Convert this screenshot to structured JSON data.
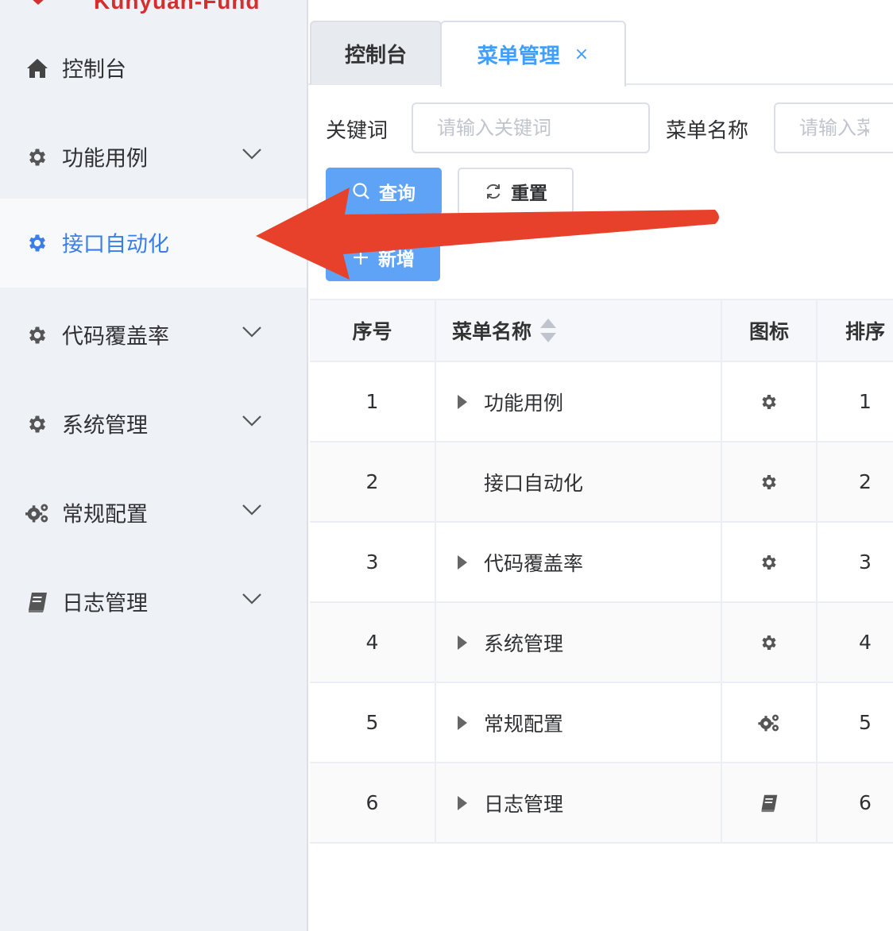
{
  "brand": {
    "name": "Kunyuan-Fund"
  },
  "sidebar": {
    "items": [
      {
        "label": "控制台",
        "icon": "home-icon",
        "has_children": false,
        "active": false
      },
      {
        "label": "功能用例",
        "icon": "gear-icon",
        "has_children": true,
        "active": false
      },
      {
        "label": "接口自动化",
        "icon": "gear-icon",
        "has_children": false,
        "active": true
      },
      {
        "label": "代码覆盖率",
        "icon": "gear-icon",
        "has_children": true,
        "active": false
      },
      {
        "label": "系统管理",
        "icon": "gear-icon",
        "has_children": true,
        "active": false
      },
      {
        "label": "常规配置",
        "icon": "gears-icon",
        "has_children": true,
        "active": false
      },
      {
        "label": "日志管理",
        "icon": "book-icon",
        "has_children": true,
        "active": false
      }
    ]
  },
  "tabs": [
    {
      "label": "控制台",
      "active": false
    },
    {
      "label": "菜单管理",
      "active": true,
      "close": "×"
    }
  ],
  "search": {
    "keyword_label": "关键词",
    "keyword_placeholder": "请输入关键词",
    "menu_name_label": "菜单名称",
    "menu_name_placeholder": "请输入菜单名称"
  },
  "buttons": {
    "query": "查询",
    "reset": "重置",
    "add": "新增"
  },
  "table": {
    "columns": [
      "序号",
      "菜单名称",
      "图标",
      "排序"
    ],
    "rows": [
      {
        "index": "1",
        "name": "功能用例",
        "icon": "gear-icon",
        "order": "1",
        "expandable": true
      },
      {
        "index": "2",
        "name": "接口自动化",
        "icon": "gear-icon",
        "order": "2",
        "expandable": false
      },
      {
        "index": "3",
        "name": "代码覆盖率",
        "icon": "gear-icon",
        "order": "3",
        "expandable": true
      },
      {
        "index": "4",
        "name": "系统管理",
        "icon": "gear-icon",
        "order": "4",
        "expandable": true
      },
      {
        "index": "5",
        "name": "常规配置",
        "icon": "gears-icon",
        "order": "5",
        "expandable": true
      },
      {
        "index": "6",
        "name": "日志管理",
        "icon": "book-icon",
        "order": "6",
        "expandable": true
      }
    ]
  },
  "colors": {
    "accent": "#409eff",
    "primary_button": "#5ea3f5",
    "sidebar_bg": "#eef1f6",
    "active_text": "#3a7eea",
    "annotation_arrow": "#e8412b"
  }
}
